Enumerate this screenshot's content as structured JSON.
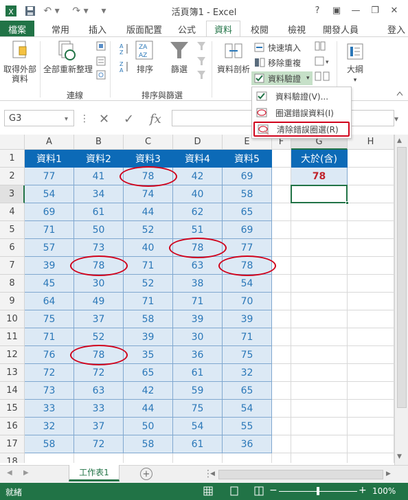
{
  "window": {
    "title": "活頁簿1 - Excel",
    "help": "?",
    "login": "登入"
  },
  "tabs": [
    "檔案",
    "常用",
    "插入",
    "版面配置",
    "公式",
    "資料",
    "校閱",
    "檢視",
    "開發人員"
  ],
  "ribbon": {
    "get_external": "取得外部\n資料",
    "refresh_all": "全部重新整理",
    "connections_group": "連線",
    "sort": "排序",
    "filter": "篩選",
    "sort_filter_group": "排序與篩選",
    "text_to_columns": "資料剖析",
    "flash_fill": "快速填入",
    "remove_duplicates": "移除重複",
    "data_validation": "資料驗證",
    "outline": "大綱"
  },
  "dropdown": {
    "items": [
      "資料驗證(V)...",
      "圈選錯誤資料(I)",
      "清除錯誤圈選(R)"
    ]
  },
  "formula_bar": {
    "name_box": "G3",
    "fx_label": "fx",
    "formula": ""
  },
  "columns": [
    "A",
    "B",
    "C",
    "D",
    "E",
    "F",
    "G",
    "H"
  ],
  "rows": [
    "1",
    "2",
    "3",
    "4",
    "5",
    "6",
    "7",
    "8",
    "9",
    "10",
    "11",
    "12",
    "13",
    "14",
    "15",
    "16",
    "17",
    "18"
  ],
  "table": {
    "headers": [
      "資料1",
      "資料2",
      "資料3",
      "資料4",
      "資料5"
    ],
    "data": [
      [
        77,
        41,
        78,
        42,
        69
      ],
      [
        54,
        34,
        74,
        40,
        58
      ],
      [
        69,
        61,
        44,
        62,
        65
      ],
      [
        71,
        50,
        52,
        51,
        69
      ],
      [
        57,
        73,
        40,
        78,
        77
      ],
      [
        39,
        78,
        71,
        63,
        78
      ],
      [
        45,
        30,
        52,
        38,
        54
      ],
      [
        64,
        49,
        71,
        71,
        70
      ],
      [
        75,
        37,
        58,
        39,
        39
      ],
      [
        71,
        52,
        39,
        30,
        71
      ],
      [
        76,
        78,
        35,
        36,
        75
      ],
      [
        72,
        72,
        65,
        61,
        32
      ],
      [
        73,
        63,
        42,
        59,
        65
      ],
      [
        33,
        33,
        44,
        75,
        54
      ],
      [
        32,
        37,
        50,
        54,
        55
      ],
      [
        58,
        72,
        58,
        61,
        36
      ]
    ]
  },
  "criteria": {
    "header": "大於(含)",
    "value": "78"
  },
  "sheet_tab": "工作表1",
  "status": {
    "ready": "就緒",
    "zoom": "100%"
  },
  "colors": {
    "excel_green": "#217346",
    "header_blue": "#0c6ab7",
    "data_fill": "#dce9f5",
    "circle_red": "#d0021b"
  }
}
